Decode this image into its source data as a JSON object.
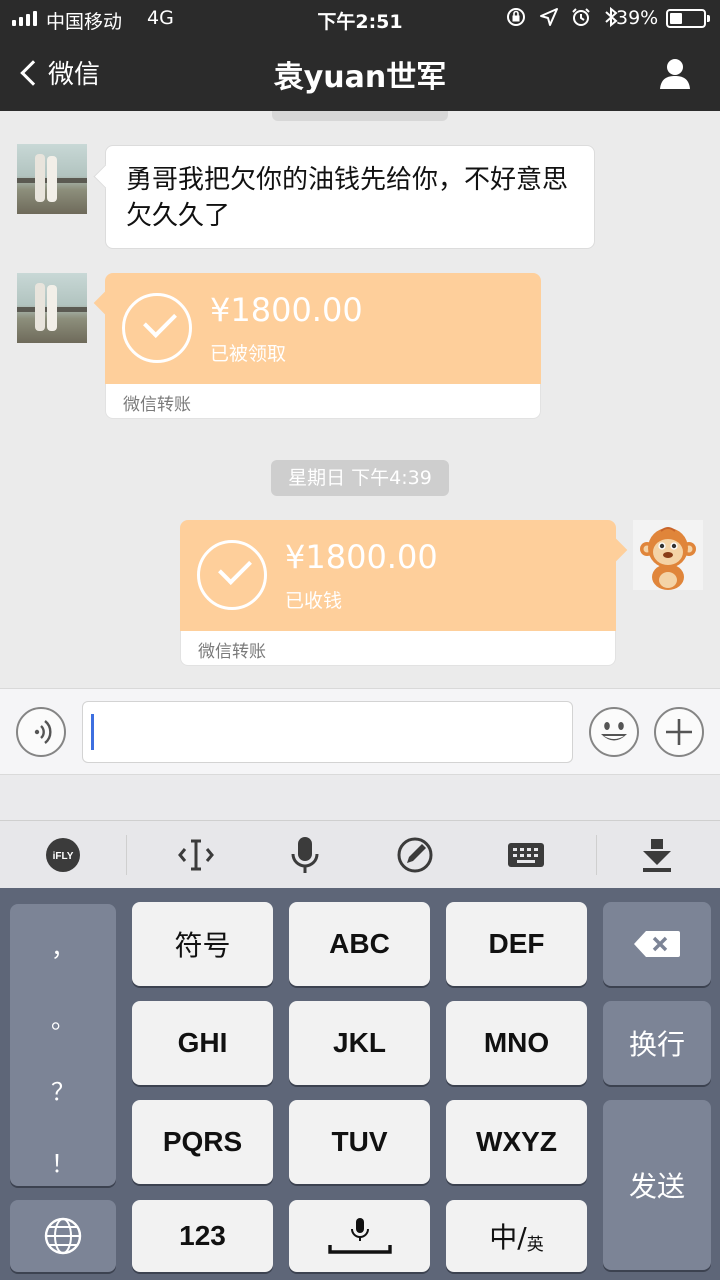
{
  "status_bar": {
    "carrier": "中国移动",
    "network": "4G",
    "time": "下午2:51",
    "battery": "39%",
    "battery_level": 0.39
  },
  "nav": {
    "back_label": "微信",
    "title": "袁yuan世军"
  },
  "messages": {
    "msg1_text": "勇哥我把欠你的油钱先给你，不好意思欠久久了",
    "transfer1": {
      "amount": "¥1800.00",
      "status": "已被领取",
      "label": "微信转账"
    },
    "timestamp": "星期日 下午4:39",
    "transfer2": {
      "amount": "¥1800.00",
      "status": "已收钱",
      "label": "微信转账"
    }
  },
  "input": {
    "value": ""
  },
  "toolbar": {
    "icons": [
      "ifly-logo-icon",
      "cursor-move-icon",
      "microphone-icon",
      "pen-icon",
      "keyboard-icon",
      "hide-keyboard-icon"
    ],
    "ifly_label": "iFLY"
  },
  "keyboard": {
    "punctuation": [
      "，",
      "。",
      "？",
      "！"
    ],
    "row1": [
      "符号",
      "ABC",
      "DEF"
    ],
    "row2": [
      "GHI",
      "JKL",
      "MNO"
    ],
    "row3": [
      "PQRS",
      "TUV",
      "WXYZ"
    ],
    "num_key": "123",
    "lang_key_main": "中/",
    "lang_key_sub": "英",
    "newline_key": "换行",
    "send_key": "发送"
  },
  "colors": {
    "nav_bg": "#2b2b2b",
    "transfer_orange": "#fecf9b",
    "keyboard_bg": "#5e6678"
  }
}
